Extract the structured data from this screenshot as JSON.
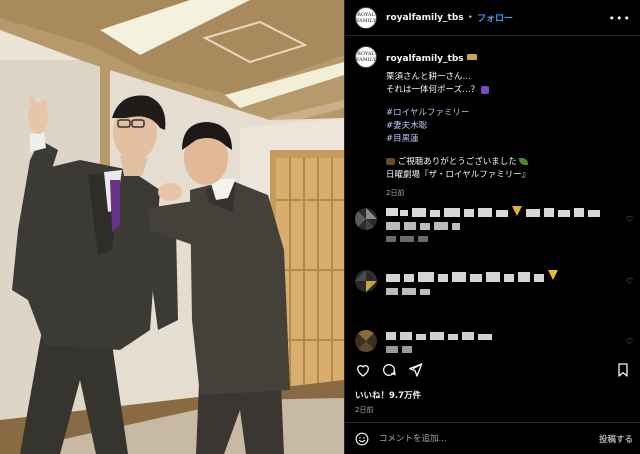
{
  "header": {
    "username": "royalfamily_tbs",
    "separator": "•",
    "follow_label": "フォロー",
    "avatar_text": "ROYAL FAMILY",
    "more_icon": "more-horizontal-icon"
  },
  "caption": {
    "username": "royalfamily_tbs",
    "line1": "栗須さんと耕一さん…",
    "line2": "それは一体何ポーズ…？",
    "hashtags": [
      "#ロイヤルファミリー",
      "#妻夫木聡",
      "#目黒蓮"
    ],
    "thanks": "ご視聴ありがとうございました",
    "program": "日曜劇場『ザ・ロイヤルファミリー』",
    "time": "2日前"
  },
  "comments": [
    {
      "avatar": "blurred-avatar",
      "text_hidden": true
    },
    {
      "avatar": "blurred-avatar",
      "text_hidden": true
    },
    {
      "avatar": "blurred-avatar",
      "text_hidden": true
    }
  ],
  "actions": {
    "like_icon": "heart-icon",
    "comment_icon": "comment-icon",
    "share_icon": "send-icon",
    "save_icon": "bookmark-icon"
  },
  "likes": "いいね！9.7万件",
  "time": "2日前",
  "add_comment": {
    "placeholder": "コメントを追加...",
    "post_label": "投稿する",
    "emoji_icon": "smiley-icon"
  },
  "colors": {
    "link": "#4a9df8",
    "hashtag": "#b8c6f5",
    "muted": "#a8a8a8",
    "background": "#000000"
  }
}
